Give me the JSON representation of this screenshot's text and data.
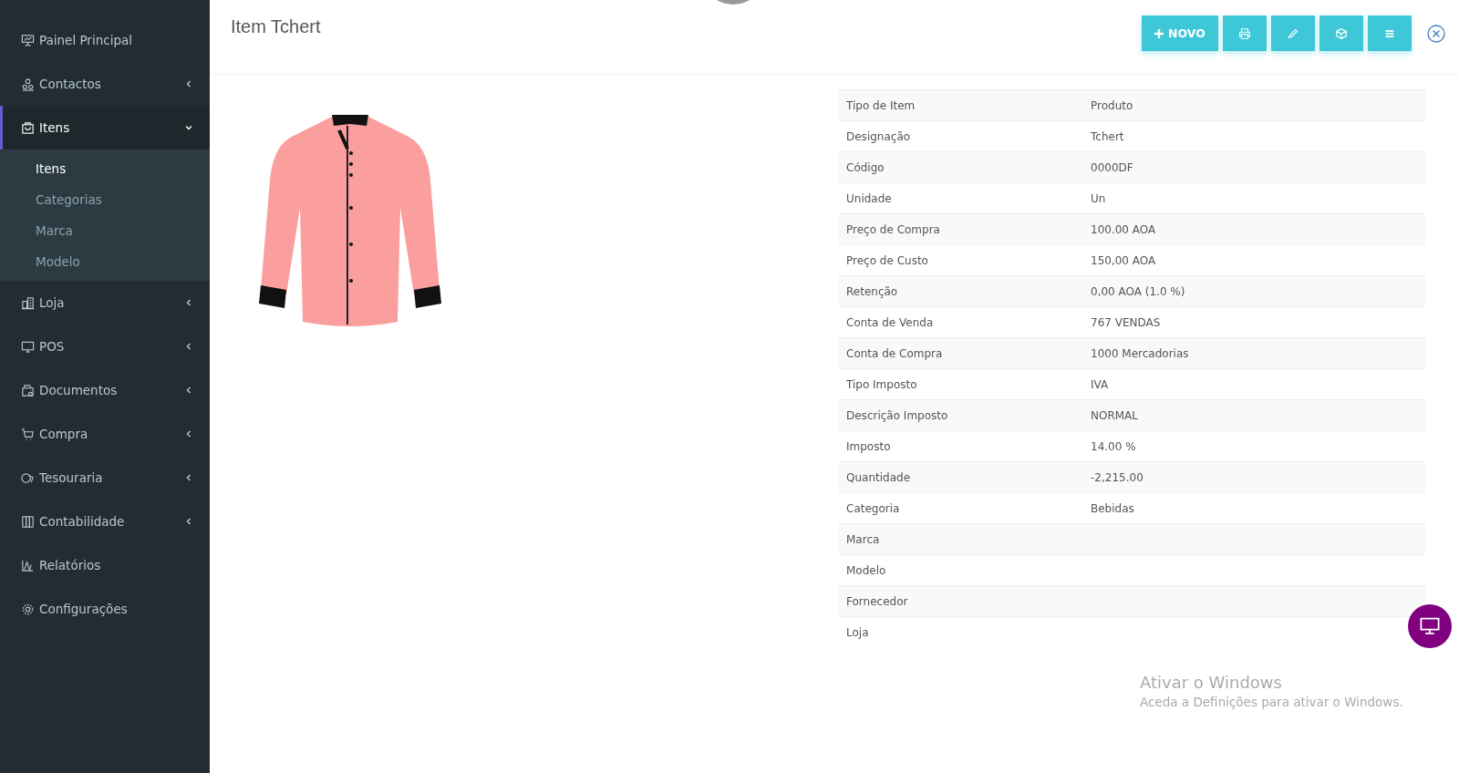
{
  "sidebar": {
    "items": [
      {
        "label": "Painel Principal",
        "kind": "link",
        "selected": false
      },
      {
        "label": "Contactos",
        "kind": "menu",
        "expanded": false,
        "selected": false
      },
      {
        "label": "Itens",
        "kind": "menu",
        "expanded": true,
        "selected": true,
        "children": [
          {
            "label": "Itens",
            "selected": true
          },
          {
            "label": "Categorias",
            "selected": false
          },
          {
            "label": "Marca",
            "selected": false
          },
          {
            "label": "Modelo",
            "selected": false
          }
        ]
      },
      {
        "label": "Loja",
        "kind": "menu",
        "expanded": false,
        "selected": false
      },
      {
        "label": "POS",
        "kind": "menu",
        "expanded": false,
        "selected": false
      },
      {
        "label": "Documentos",
        "kind": "menu",
        "expanded": false,
        "selected": false
      },
      {
        "label": "Compra",
        "kind": "menu",
        "expanded": false,
        "selected": false
      },
      {
        "label": "Tesouraria",
        "kind": "menu",
        "expanded": false,
        "selected": false
      },
      {
        "label": "Contabilidade",
        "kind": "menu",
        "expanded": false,
        "selected": false
      },
      {
        "label": "Relatórios",
        "kind": "link",
        "selected": false
      },
      {
        "label": "Configurações",
        "kind": "link",
        "selected": false
      }
    ]
  },
  "page": {
    "title": "Item Tchert"
  },
  "toolbar": [
    {
      "kind": "new",
      "label": "NOVO"
    },
    {
      "kind": "print"
    },
    {
      "kind": "edit"
    },
    {
      "kind": "box"
    },
    {
      "kind": "menu"
    }
  ],
  "details": [
    {
      "label": "Tipo de Item",
      "value": "Produto"
    },
    {
      "label": "Designação",
      "value": "Tchert"
    },
    {
      "label": "Código",
      "value": "0000DF"
    },
    {
      "label": "Unidade",
      "value": "Un"
    },
    {
      "label": "Preço de Compra",
      "value": "100.00 AOA"
    },
    {
      "label": "Preço de Custo",
      "value": "150,00 AOA"
    },
    {
      "label": "Retenção",
      "value": "0,00 AOA (1.0 %)"
    },
    {
      "label": "Conta de Venda",
      "value": "767 VENDAS"
    },
    {
      "label": "Conta de Compra",
      "value": "1000 Mercadorias"
    },
    {
      "label": "Tipo Imposto",
      "value": "IVA"
    },
    {
      "label": "Descrição Imposto",
      "value": "NORMAL"
    },
    {
      "label": "Imposto",
      "value": "14.00 %"
    },
    {
      "label": "Quantidade",
      "value": "-2,215.00"
    },
    {
      "label": "Categoria",
      "value": "Bebidas"
    },
    {
      "label": "Marca"
    },
    {
      "label": "Modelo"
    },
    {
      "label": "Fornecedor"
    },
    {
      "label": "Loja"
    }
  ],
  "os_notice": {
    "title": "Ativar o Windows",
    "text": "Aceda a Definições para ativar o Windows."
  }
}
